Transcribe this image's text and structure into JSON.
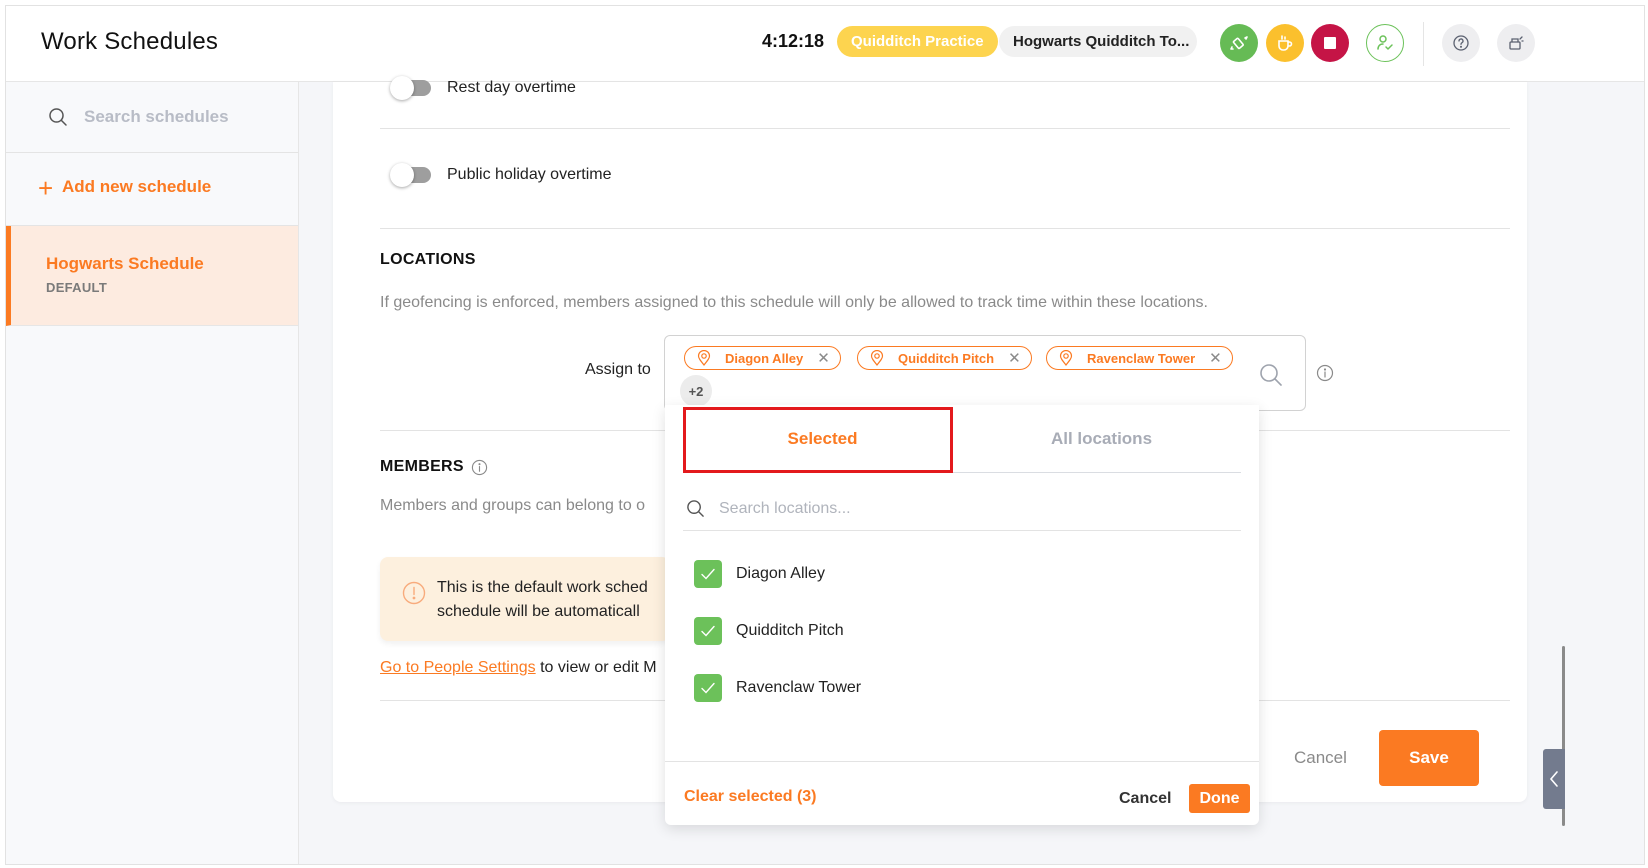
{
  "header": {
    "title": "Work Schedules",
    "timer": "4:12:18",
    "activity": "Quidditch Practice",
    "project": "Hogwarts Quidditch To...",
    "buttons": {
      "switch": "switch-task-icon",
      "break": "coffee-break-icon",
      "stop": "stop-icon",
      "user": "user-check-icon",
      "help": "help-icon",
      "apps": "apps-icon"
    },
    "colors": {
      "switch": "#66bb55",
      "break": "#fbc02d",
      "stop": "#c51446",
      "activity": "#fdd44f"
    }
  },
  "sidebar": {
    "search_placeholder": "Search schedules",
    "add_label": "Add new schedule",
    "items": [
      {
        "name": "Hogwarts Schedule",
        "tag": "DEFAULT",
        "active": true
      }
    ]
  },
  "main": {
    "toggles": [
      {
        "label": "Rest day overtime",
        "on": false
      },
      {
        "label": "Public holiday overtime",
        "on": false
      }
    ],
    "locations": {
      "title": "LOCATIONS",
      "description": "If geofencing is enforced, members assigned to this schedule will only be allowed to track time within these locations.",
      "assign_label": "Assign to",
      "chips": [
        "Diagon Alley",
        "Quidditch Pitch",
        "Ravenclaw Tower"
      ],
      "more_count": "+2"
    },
    "members": {
      "title": "MEMBERS",
      "description": "Members and groups can belong to o",
      "alert_line1": "This is the default work sched",
      "alert_line2": "schedule will be automaticall",
      "link_text": "Go to People Settings",
      "link_rest": " to view or edit M"
    },
    "cancel_label": "Cancel",
    "save_label": "Save"
  },
  "dropdown": {
    "tabs": [
      {
        "label": "Selected",
        "active": true
      },
      {
        "label": "All locations",
        "active": false
      }
    ],
    "search_placeholder": "Search locations...",
    "options": [
      {
        "label": "Diagon Alley",
        "checked": true
      },
      {
        "label": "Quidditch Pitch",
        "checked": true
      },
      {
        "label": "Ravenclaw Tower",
        "checked": true
      }
    ],
    "clear_label": "Clear selected (3)",
    "cancel_label": "Cancel",
    "done_label": "Done"
  },
  "accent_color": "#fb7a22"
}
